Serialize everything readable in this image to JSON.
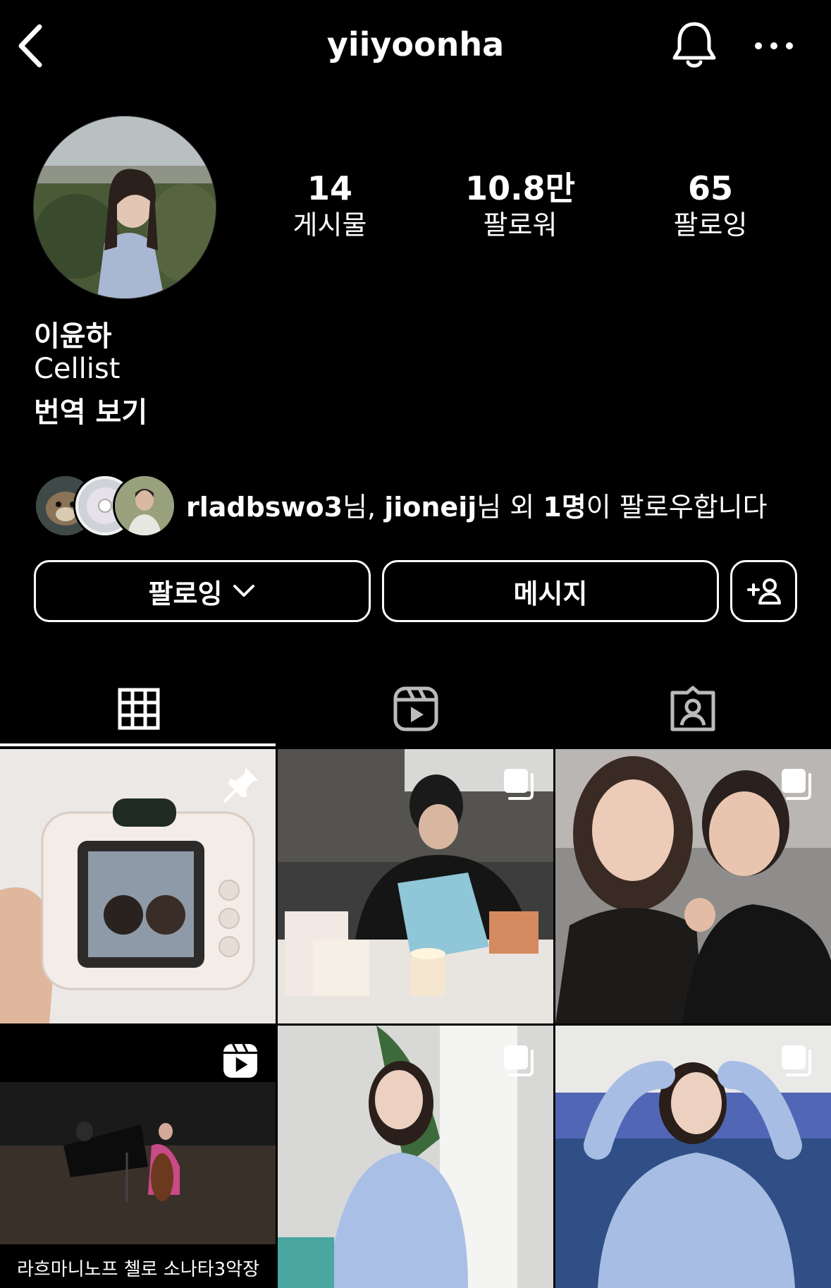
{
  "header": {
    "username": "yiiyoonha",
    "icons": {
      "back": "chevron-left-icon",
      "notifications": "bell-icon",
      "more": "more-horizontal-icon"
    }
  },
  "stats": [
    {
      "value": "14",
      "label": "게시물"
    },
    {
      "value": "10.8만",
      "label": "팔로워"
    },
    {
      "value": "65",
      "label": "팔로잉"
    }
  ],
  "bio": {
    "name": "이윤하",
    "description": "Cellist",
    "translate": "번역 보기"
  },
  "mutual": {
    "user1": "rladbswo3",
    "suffix1": "님, ",
    "user2": "jioneij",
    "suffix2": "님 외 ",
    "count": "1명",
    "suffix3": "이 팔로우합니다"
  },
  "actions": {
    "following": "팔로잉",
    "message": "메시지"
  },
  "tabs": [
    {
      "name": "posts",
      "icon": "grid-icon",
      "active": true
    },
    {
      "name": "reels",
      "icon": "reels-icon",
      "active": false
    },
    {
      "name": "tagged",
      "icon": "tagged-person-icon",
      "active": false
    }
  ],
  "posts": [
    {
      "type": "pinned",
      "icon": "pin-icon"
    },
    {
      "type": "carousel",
      "icon": "carousel-icon"
    },
    {
      "type": "carousel",
      "icon": "carousel-icon"
    },
    {
      "type": "reel",
      "icon": "reels-icon",
      "caption": "라흐마니노프 첼로 소나타3악장"
    },
    {
      "type": "carousel",
      "icon": "carousel-icon"
    },
    {
      "type": "carousel",
      "icon": "carousel-icon"
    }
  ],
  "colors": {
    "background": "#000000",
    "text": "#ffffff"
  }
}
